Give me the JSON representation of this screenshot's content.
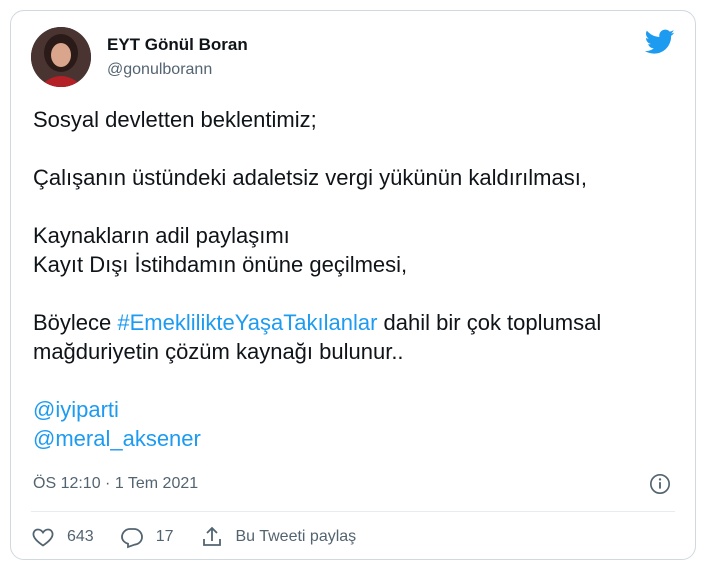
{
  "author": {
    "name": "EYT Gönül Boran",
    "handle": "@gonulborann"
  },
  "tweet": {
    "line1": "Sosyal devletten beklentimiz;",
    "line2": "Çalışanın üstündeki adaletsiz vergi yükünün kaldırılması,",
    "line3": "Kaynakların adil paylaşımı",
    "line4": "Kayıt Dışı İstihdamın önüne geçilmesi,",
    "line5_prefix": "Böylece ",
    "hashtag": "#EmeklilikteYaşaTakılanlar",
    "line5_suffix": " dahil bir çok toplumsal",
    "line6": "mağduriyetin çözüm kaynağı bulunur..",
    "mention1": "@iyiparti",
    "mention2": "@meral_aksener"
  },
  "meta": {
    "timestamp": "ÖS 12:10 · 1 Tem 2021"
  },
  "actions": {
    "likes": "643",
    "replies": "17",
    "share_label": "Bu Tweeti paylaş"
  },
  "colors": {
    "accent": "#1d9bf0",
    "text": "#0f1419",
    "muted": "#536471"
  },
  "icons": [
    "twitter-bird-icon",
    "info-icon",
    "heart-icon",
    "reply-icon",
    "share-icon"
  ]
}
